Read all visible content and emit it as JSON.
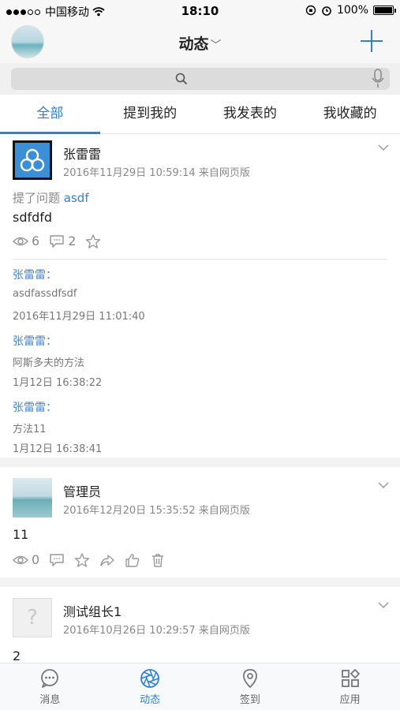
{
  "status": {
    "carrier": "中国移动",
    "time": "18:10",
    "battery": "100%"
  },
  "nav": {
    "title": "动态"
  },
  "tabs": [
    {
      "label": "全部"
    },
    {
      "label": "提到我的"
    },
    {
      "label": "我发表的"
    },
    {
      "label": "我收藏的"
    }
  ],
  "posts": [
    {
      "author": "张雷雷",
      "meta": "2016年11月29日 10:59:14 来自网页版",
      "action_prefix": "提了问题",
      "action_link": "asdf",
      "content": "sdfdfd",
      "views": "6",
      "comments_count": "2",
      "comments": [
        {
          "author": "张雷雷：",
          "text": "asdfassdfsdf",
          "time": "2016年11月29日 11:01:40"
        },
        {
          "author": "张雷雷：",
          "text": "阿斯多夫的方法",
          "time": "1月12日 16:38:22"
        },
        {
          "author": "张雷雷：",
          "text": "方法11",
          "time": "1月12日 16:38:41"
        }
      ]
    },
    {
      "author": "管理员",
      "meta": "2016年12月20日 15:35:52 来自网页版",
      "content": "11",
      "views": "0"
    },
    {
      "author": "测试组长1",
      "meta": "2016年10月26日 10:29:57 来自网页版",
      "content": "2",
      "avatar_glyph": "?"
    }
  ],
  "tabbar": [
    {
      "label": "消息",
      "icon": "message-icon"
    },
    {
      "label": "动态",
      "icon": "aperture-icon"
    },
    {
      "label": "签到",
      "icon": "location-pin-icon"
    },
    {
      "label": "应用",
      "icon": "apps-grid-icon"
    }
  ],
  "colors": {
    "accent": "#2f7fd6",
    "muted": "#888888"
  }
}
